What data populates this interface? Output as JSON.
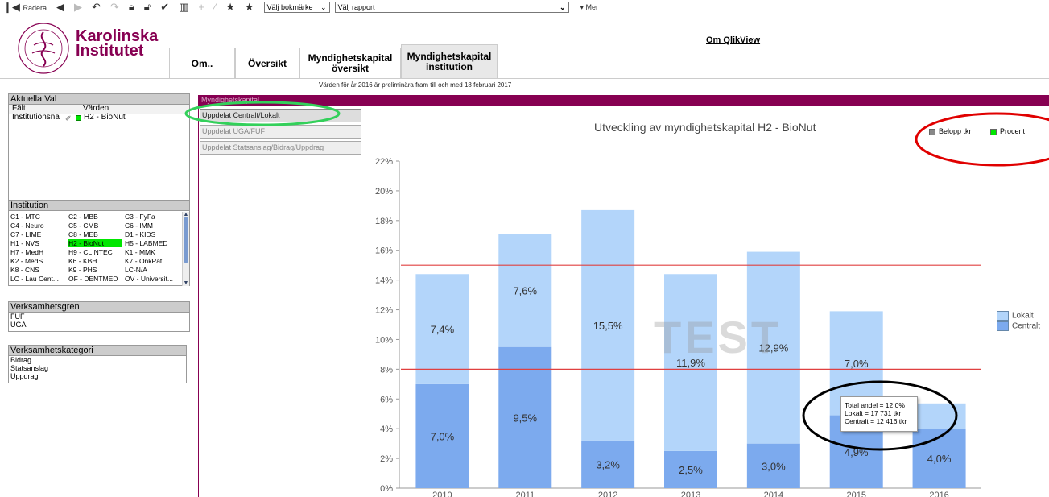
{
  "toolbar": {
    "radera_label": "Radera",
    "bookmark_select": "Välj bokmärke",
    "report_select": "Välj rapport",
    "more_label": "Mer"
  },
  "header": {
    "logo_line1": "Karolinska",
    "logo_line2": "Institutet",
    "om_qlikview": "Om QlikView",
    "prelim_note": "Värden för år 2016 är preliminära fram till och med 18 februari 2017"
  },
  "tabs": [
    {
      "label": "Om.."
    },
    {
      "label": "Översikt"
    },
    {
      "label": "Myndighetskapital översikt"
    },
    {
      "label": "Myndighetskapital institution"
    }
  ],
  "current_selections": {
    "title": "Aktuella Val",
    "col_field": "Fält",
    "col_values": "Värden",
    "field": "Institutionsna",
    "value": "H2 - BioNut"
  },
  "institution": {
    "title": "Institution",
    "rows": [
      [
        "C1 - MTC",
        "C2 - MBB",
        "C3 - FyFa"
      ],
      [
        "C4 - Neuro",
        "C5 - CMB",
        "C6 - IMM"
      ],
      [
        "C7 - LIME",
        "C8 - MEB",
        "D1 - KIDS"
      ],
      [
        "H1 - NVS",
        "H2 - BioNut",
        "H5 - LABMED"
      ],
      [
        "H7 - MedH",
        "H9 - CLINTEC",
        "K1 - MMK"
      ],
      [
        "K2 - MedS",
        "K6 - KBH",
        "K7 - OnkPat"
      ],
      [
        "K8 - CNS",
        "K9 - PHS",
        "LC-N/A"
      ],
      [
        "LC - Lau Cent...",
        "OF - DENTMED",
        "OV - Universit..."
      ]
    ],
    "selected": "H2 - BioNut"
  },
  "verksamhetsgren": {
    "title": "Verksamhetsgren",
    "items": [
      "FUF",
      "UGA"
    ]
  },
  "verksamhetskategori": {
    "title": "Verksamhetskategori",
    "items": [
      "Bidrag",
      "Statsanslag",
      "Uppdrag"
    ]
  },
  "section_bar": {
    "label": "Myndighetskapital"
  },
  "split_buttons": [
    {
      "label": "Uppdelat Centralt/Lokalt",
      "active": true
    },
    {
      "label": "Uppdelat UGA/FUF",
      "active": false
    },
    {
      "label": "Uppdelat Statsanslag/Bidrag/Uppdrag",
      "active": false
    }
  ],
  "mode_toggle": {
    "belopp": "Belopp tkr",
    "procent": "Procent"
  },
  "watermark": "TEST",
  "tooltip": {
    "line1": "Total andel = 12,0%",
    "line2": "Lokalt = 17 731 tkr",
    "line3": "Centralt = 12 416 tkr"
  },
  "colors": {
    "lokalt": "#b3d5fa",
    "centralt": "#7caaee",
    "threshold": "#e04040",
    "brand": "#870052",
    "selected_green": "#00e600"
  },
  "chart_data": {
    "type": "bar",
    "stacked": true,
    "title": "Utveckling av myndighetskapital H2 - BioNut",
    "categories": [
      "2010",
      "2011",
      "2012",
      "2013",
      "2014",
      "2015",
      "2016"
    ],
    "series": [
      {
        "name": "Centralt",
        "values": [
          7.0,
          9.5,
          3.2,
          2.5,
          3.0,
          4.9,
          4.0
        ],
        "labels": [
          "7,0%",
          "9,5%",
          "3,2%",
          "2,5%",
          "3,0%",
          "4,9%",
          "4,0%"
        ]
      },
      {
        "name": "Lokalt",
        "values": [
          7.4,
          7.6,
          15.5,
          11.9,
          12.9,
          7.0,
          1.7
        ],
        "labels": [
          "7,4%",
          "7,6%",
          "15,5%",
          "11,9%",
          "12,9%",
          "7,0%",
          ""
        ]
      }
    ],
    "ylim": [
      0,
      22
    ],
    "yticks": [
      "0%",
      "2%",
      "4%",
      "6%",
      "8%",
      "10%",
      "12%",
      "14%",
      "16%",
      "18%",
      "20%",
      "22%"
    ],
    "thresholds": [
      8,
      15
    ],
    "legend": "right"
  }
}
